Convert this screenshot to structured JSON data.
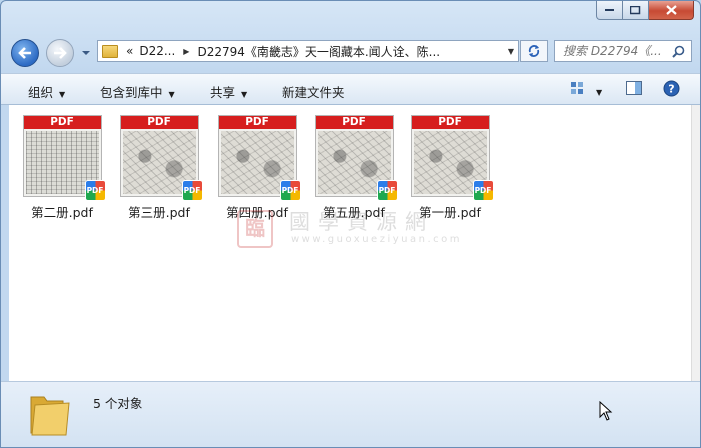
{
  "window": {
    "minimize_icon": "minimize-icon",
    "maximize_icon": "maximize-icon",
    "close_icon": "close-icon"
  },
  "address": {
    "overflow": "«",
    "crumbs": [
      "D22...",
      "D22794《南畿志》天一阁藏本.闻人诠、陈..."
    ]
  },
  "search": {
    "placeholder": "搜索 D22794《..."
  },
  "toolbar": {
    "organize": "组织",
    "include_in_library": "包含到库中",
    "share": "共享",
    "new_folder": "新建文件夹"
  },
  "files": [
    {
      "name": "第二册.pdf",
      "banner": "PDF",
      "badge": "PDF",
      "thumb": "text"
    },
    {
      "name": "第三册.pdf",
      "banner": "PDF",
      "badge": "PDF",
      "thumb": "map"
    },
    {
      "name": "第四册.pdf",
      "banner": "PDF",
      "badge": "PDF",
      "thumb": "map"
    },
    {
      "name": "第五册.pdf",
      "banner": "PDF",
      "badge": "PDF",
      "thumb": "map"
    },
    {
      "name": "第一册.pdf",
      "banner": "PDF",
      "badge": "PDF",
      "thumb": "map"
    }
  ],
  "watermark": {
    "seal": "臨",
    "title": "國學資源網",
    "url": "www.guoxueziyuan.com"
  },
  "details": {
    "count_text": "5 个对象"
  },
  "colors": {
    "pdf_banner": "#d61e1e",
    "window_chrome": "#c2d8ef",
    "close_button": "#c74a34"
  }
}
